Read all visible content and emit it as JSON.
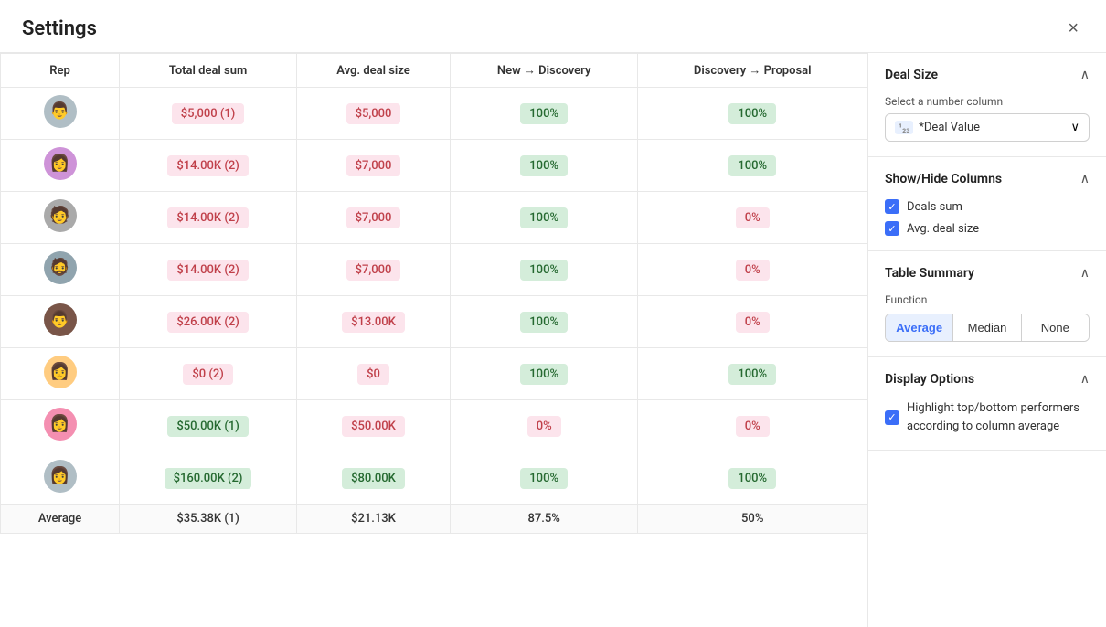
{
  "modal": {
    "title": "Settings",
    "close_label": "×"
  },
  "table": {
    "columns": [
      "Rep",
      "Total deal sum",
      "Avg. deal size",
      "New → Discovery",
      "Discovery → Proposal"
    ],
    "rows": [
      {
        "avatar": "👨",
        "avatar_bg": "#b0c4de",
        "total_deal": "$5,000 (1)",
        "total_deal_type": "pink",
        "avg_deal": "$5,000",
        "avg_deal_type": "pink",
        "new_disc": "100%",
        "new_disc_type": "green",
        "disc_prop": "100%",
        "disc_prop_type": "green"
      },
      {
        "avatar": "👩",
        "avatar_bg": "#c8a0c0",
        "total_deal": "$14.00K (2)",
        "total_deal_type": "pink",
        "avg_deal": "$7,000",
        "avg_deal_type": "pink",
        "new_disc": "100%",
        "new_disc_type": "green",
        "disc_prop": "100%",
        "disc_prop_type": "green"
      },
      {
        "avatar": "👩",
        "avatar_bg": "#888",
        "total_deal": "$14.00K (2)",
        "total_deal_type": "pink",
        "avg_deal": "$7,000",
        "avg_deal_type": "pink",
        "new_disc": "100%",
        "new_disc_type": "green",
        "disc_prop": "0%",
        "disc_prop_type": "pink"
      },
      {
        "avatar": "🧔",
        "avatar_bg": "#a0b0c8",
        "total_deal": "$14.00K (2)",
        "total_deal_type": "pink",
        "avg_deal": "$7,000",
        "avg_deal_type": "pink",
        "new_disc": "100%",
        "new_disc_type": "green",
        "disc_prop": "0%",
        "disc_prop_type": "pink"
      },
      {
        "avatar": "👨",
        "avatar_bg": "#8B7355",
        "total_deal": "$26.00K (2)",
        "total_deal_type": "pink",
        "avg_deal": "$13.00K",
        "avg_deal_type": "pink",
        "new_disc": "100%",
        "new_disc_type": "green",
        "disc_prop": "0%",
        "disc_prop_type": "pink"
      },
      {
        "avatar": "👩",
        "avatar_bg": "#d4a080",
        "total_deal": "$0 (2)",
        "total_deal_type": "pink",
        "avg_deal": "$0",
        "avg_deal_type": "pink",
        "new_disc": "100%",
        "new_disc_type": "green",
        "disc_prop": "100%",
        "disc_prop_type": "green"
      },
      {
        "avatar": "👩",
        "avatar_bg": "#c0a0b0",
        "total_deal": "$50.00K (1)",
        "total_deal_type": "green",
        "avg_deal": "$50.00K",
        "avg_deal_type": "pink",
        "new_disc": "0%",
        "new_disc_type": "pink",
        "disc_prop": "0%",
        "disc_prop_type": "pink"
      },
      {
        "avatar": "👩",
        "avatar_bg": "#b0b0b0",
        "total_deal": "$160.00K (2)",
        "total_deal_type": "green",
        "avg_deal": "$80.00K",
        "avg_deal_type": "green",
        "new_disc": "100%",
        "new_disc_type": "green",
        "disc_prop": "100%",
        "disc_prop_type": "green"
      }
    ],
    "summary": {
      "label": "Average",
      "total_deal": "$35.38K (1)",
      "avg_deal": "$21.13K",
      "new_disc": "87.5%",
      "disc_prop": "50%"
    }
  },
  "sidebar": {
    "deal_size": {
      "title": "Deal Size",
      "select_label": "Select a number column",
      "select_icon": "¹₂₃",
      "select_value": "*Deal Value",
      "chevron": "∧"
    },
    "show_hide": {
      "title": "Show/Hide Columns",
      "chevron": "∧",
      "items": [
        {
          "label": "Deals sum",
          "checked": true
        },
        {
          "label": "Avg. deal size",
          "checked": true
        }
      ]
    },
    "table_summary": {
      "title": "Table Summary",
      "chevron": "∧",
      "function_label": "Function",
      "buttons": [
        "Average",
        "Median",
        "None"
      ],
      "active_button": "Average"
    },
    "display_options": {
      "title": "Display Options",
      "chevron": "∧",
      "highlight_text": "Highlight top/bottom performers according to column average",
      "highlight_checked": true
    }
  }
}
